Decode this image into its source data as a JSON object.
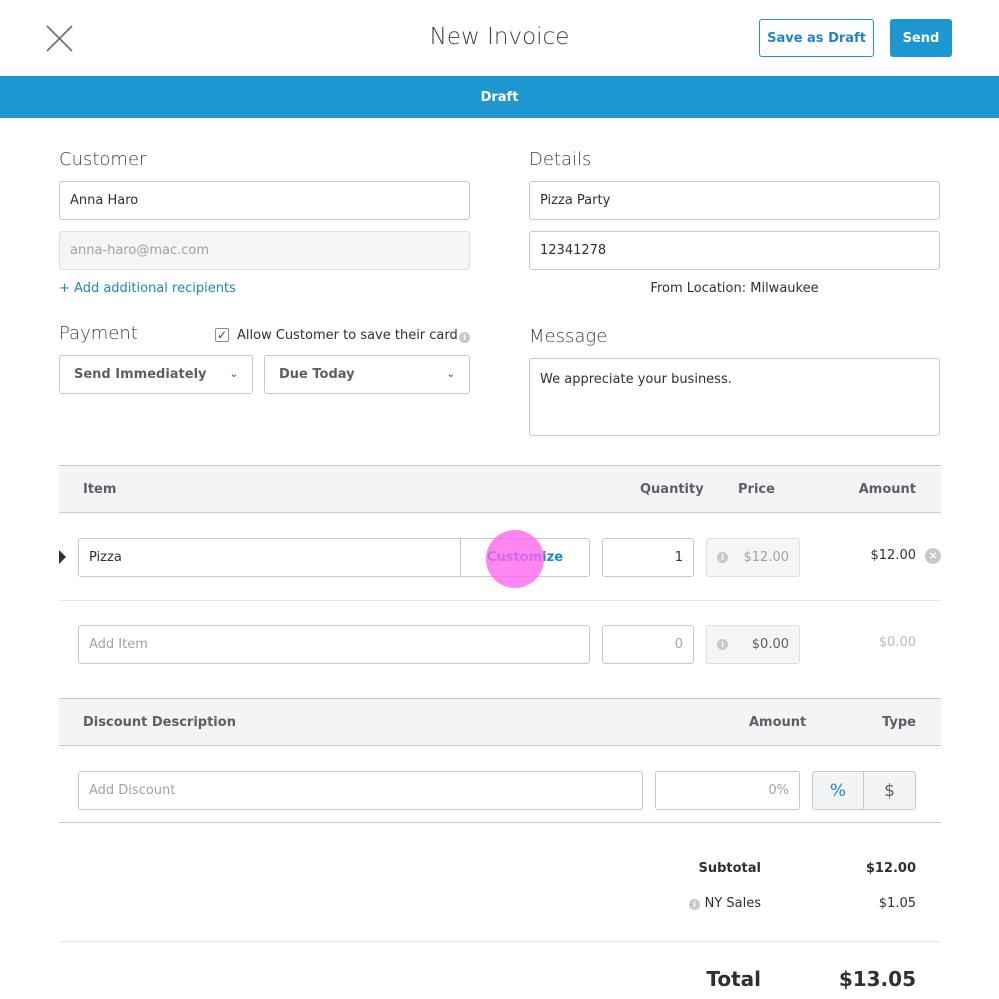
{
  "header": {
    "title": "New Invoice",
    "save_draft": "Save as Draft",
    "send": "Send"
  },
  "status_banner": "Draft",
  "customer": {
    "heading": "Customer",
    "name": "Anna Haro",
    "email": "anna-haro@mac.com",
    "add_recipients": "+ Add additional recipients"
  },
  "details": {
    "heading": "Details",
    "title": "Pizza Party",
    "invoice_number": "12341278",
    "from_location": "From Location: Milwaukee"
  },
  "payment": {
    "heading": "Payment",
    "save_card_label": "Allow Customer to save their card",
    "save_card_checked": true,
    "send_option": "Send Immediately",
    "due_option": "Due Today"
  },
  "message": {
    "heading": "Message",
    "text": "We appreciate your business."
  },
  "items_table": {
    "headers": {
      "item": "Item",
      "quantity": "Quantity",
      "price": "Price",
      "amount": "Amount"
    },
    "rows": [
      {
        "name": "Pizza",
        "customize": "Customize",
        "quantity": "1",
        "price": "$12.00",
        "amount": "$12.00"
      }
    ],
    "new_row": {
      "placeholder": "Add Item",
      "quantity": "0",
      "price": "$0.00",
      "amount": "$0.00"
    }
  },
  "discount_table": {
    "headers": {
      "description": "Discount Description",
      "amount": "Amount",
      "type": "Type"
    },
    "placeholder": "Add Discount",
    "amount_placeholder": "0%",
    "type_percent": "%",
    "type_dollar": "$"
  },
  "totals": {
    "subtotal_label": "Subtotal",
    "subtotal": "$12.00",
    "tax_label": "NY Sales",
    "tax": "$1.05",
    "total_label": "Total",
    "total": "$13.05"
  },
  "colors": {
    "accent": "#1e96cf",
    "click_indicator": "#ff66ee"
  }
}
